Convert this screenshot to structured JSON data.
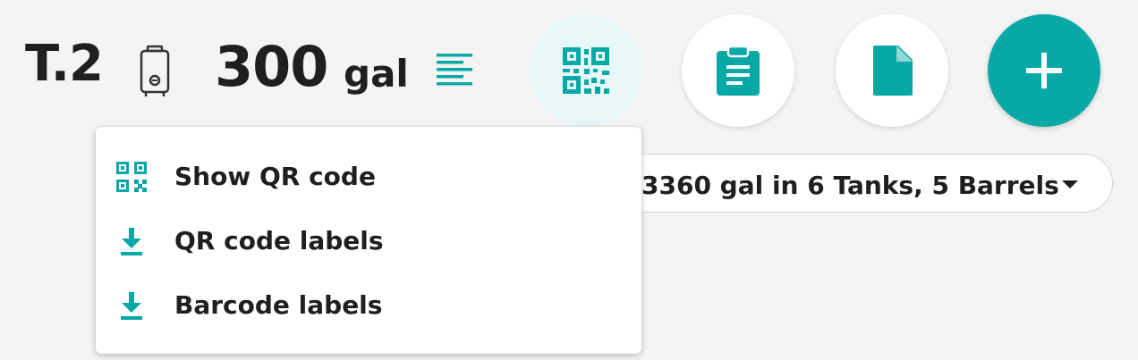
{
  "header": {
    "tank_name": "T.2",
    "volume_value": "300",
    "volume_unit": "gal"
  },
  "icons": {
    "tank": "tank-icon",
    "details": "notes-list-icon",
    "qr": "qr-code-icon",
    "clipboard": "clipboard-icon",
    "document": "document-icon",
    "add": "plus-icon",
    "download": "download-icon",
    "caret": "caret-down-icon"
  },
  "summary": {
    "text": "3360 gal in 6 Tanks, 5 Barrels"
  },
  "menu": {
    "items": [
      {
        "label": "Show QR code",
        "icon": "qr-code-icon"
      },
      {
        "label": "QR code labels",
        "icon": "download-icon"
      },
      {
        "label": "Barcode labels",
        "icon": "download-icon"
      }
    ]
  },
  "colors": {
    "accent": "#08a8a6",
    "active_button_bg": "#e8f8f9",
    "text": "#1f1f1f",
    "background": "#f4f4f4"
  }
}
